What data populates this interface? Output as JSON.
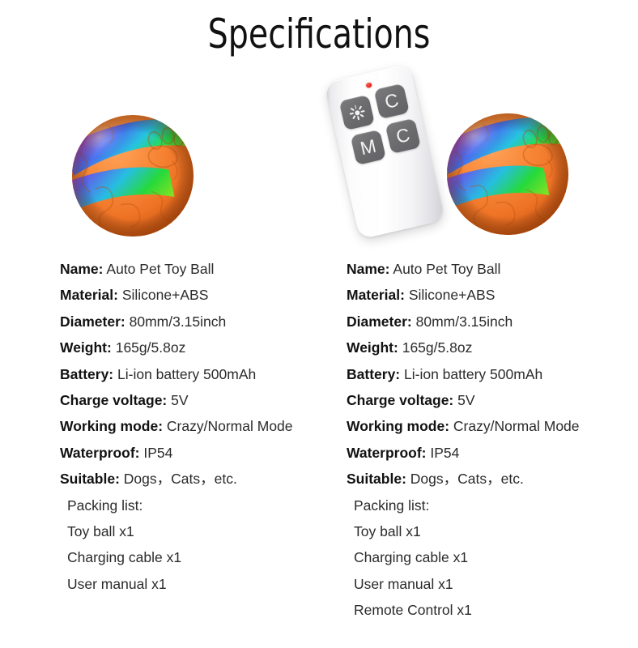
{
  "page": {
    "title": "Specifications",
    "background_color": "#ffffff"
  },
  "product_images": {
    "ball_left": {
      "icon": "pet-toy-ball",
      "body_color": "#F0772A",
      "stripe_colors": [
        "#FF1FBF",
        "#A13CE8",
        "#3C6CF0",
        "#22C8E0",
        "#22DD22",
        "#8CE020"
      ]
    },
    "ball_right": {
      "icon": "pet-toy-ball",
      "body_color": "#F0772A",
      "stripe_colors": [
        "#FF1FBF",
        "#A13CE8",
        "#3C6CF0",
        "#22C8E0",
        "#22DD22",
        "#8CE020"
      ]
    },
    "remote": {
      "icon": "remote-control",
      "body_color": "#ffffff",
      "led_color": "#e51f13",
      "button_color": "#6d6d70",
      "buttons": [
        {
          "icon": "brightness-sun-icon",
          "label": ""
        },
        {
          "icon": "letter-c-icon",
          "label": "C"
        },
        {
          "icon": "letter-m-icon",
          "label": "M"
        },
        {
          "icon": "letter-c-icon",
          "label": "C"
        }
      ]
    }
  },
  "columns": [
    {
      "id": "left",
      "specs": [
        {
          "label": "Name:",
          "value": "Auto Pet Toy Ball"
        },
        {
          "label": "Material:",
          "value": "Silicone+ABS"
        },
        {
          "label": "Diameter:",
          "value": "80mm/3.15inch"
        },
        {
          "label": "Weight:",
          "value": "165g/5.8oz"
        },
        {
          "label": "Battery:",
          "value": "Li-ion battery 500mAh"
        },
        {
          "label": "Charge voltage:",
          "value": "5V"
        },
        {
          "label": "Working mode:",
          "value": "Crazy/Normal Mode"
        },
        {
          "label": "Waterproof:",
          "value": "IP54"
        },
        {
          "label": "Suitable:",
          "value": "Dogs，Cats，etc."
        }
      ],
      "packing_list": [
        "Packing list:",
        "Toy ball x1",
        "Charging cable x1",
        "User manual x1"
      ]
    },
    {
      "id": "right",
      "specs": [
        {
          "label": "Name:",
          "value": "Auto Pet Toy Ball"
        },
        {
          "label": "Material:",
          "value": "Silicone+ABS"
        },
        {
          "label": "Diameter:",
          "value": "80mm/3.15inch"
        },
        {
          "label": "Weight:",
          "value": "165g/5.8oz"
        },
        {
          "label": "Battery:",
          "value": "Li-ion battery 500mAh"
        },
        {
          "label": "Charge voltage:",
          "value": "5V"
        },
        {
          "label": "Working mode:",
          "value": "Crazy/Normal Mode"
        },
        {
          "label": "Waterproof:",
          "value": "IP54"
        },
        {
          "label": "Suitable:",
          "value": "Dogs，Cats，etc."
        }
      ],
      "packing_list": [
        "Packing list:",
        "Toy ball x1",
        "Charging cable x1",
        "User manual x1",
        "Remote Control x1"
      ]
    }
  ]
}
